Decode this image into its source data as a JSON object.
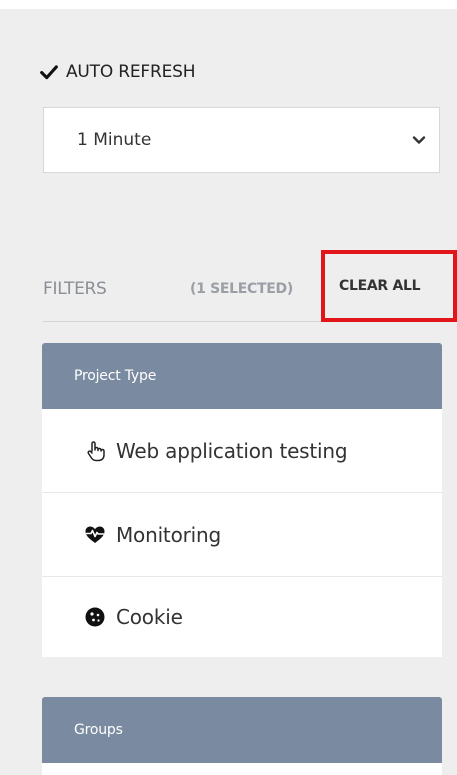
{
  "auto_refresh": {
    "checked": true,
    "label": "AUTO REFRESH",
    "interval_selected": "1 Minute"
  },
  "filters": {
    "label": "FILTERS",
    "selected_count": "(1 SELECTED)",
    "clear_all_label": "CLEAR ALL"
  },
  "project_type": {
    "title": "Project Type",
    "items": [
      {
        "label": "Web application testing",
        "icon": "pointer-hand-icon"
      },
      {
        "label": "Monitoring",
        "icon": "heart-pulse-icon"
      },
      {
        "label": "Cookie",
        "icon": "cookie-icon"
      }
    ]
  },
  "groups": {
    "title": "Groups"
  },
  "colors": {
    "panel_header": "#7a8ba1",
    "highlight_border": "#e0161b",
    "background": "#eeeeee"
  }
}
